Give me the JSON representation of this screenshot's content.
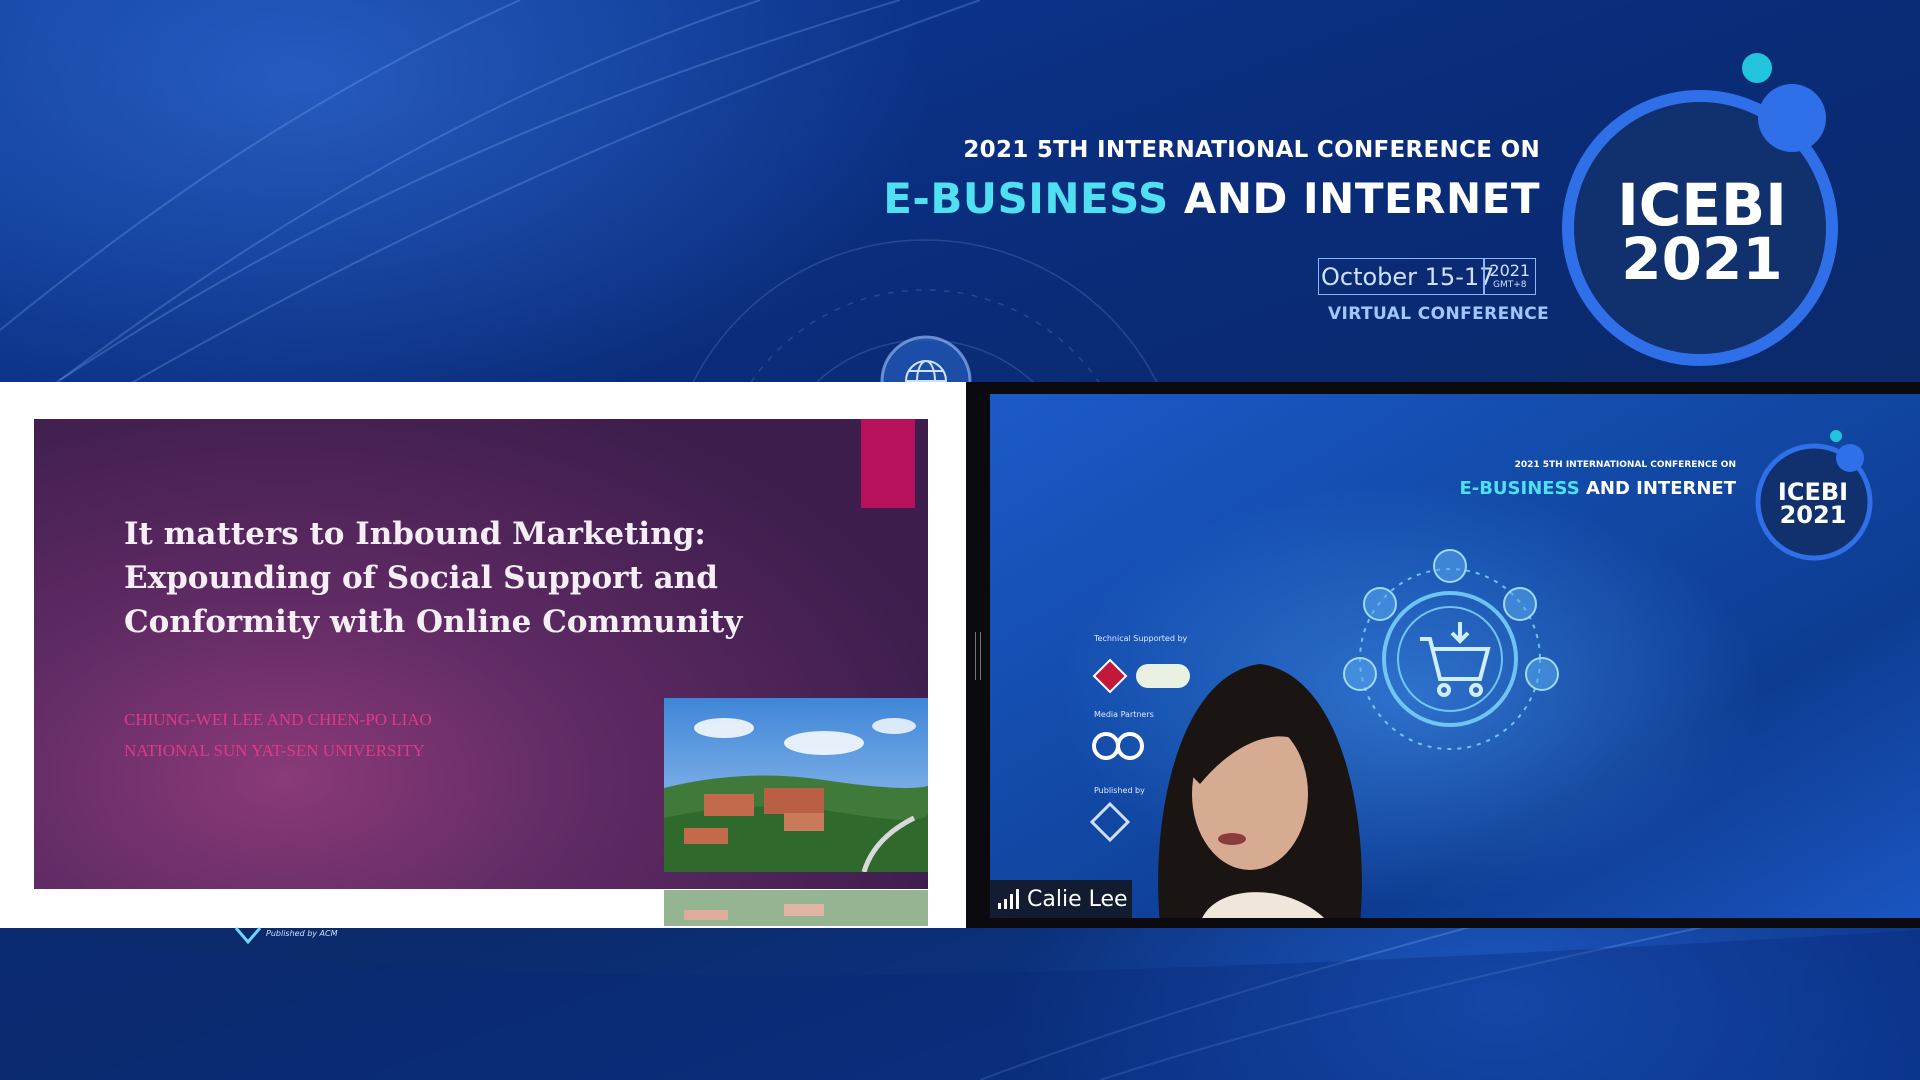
{
  "header": {
    "line1": "2021 5TH INTERNATIONAL CONFERENCE ON",
    "line2_accent": "E-BUSINESS",
    "line2_rest": " AND INTERNET",
    "date": "October 15-17",
    "year": "2021",
    "timezone": "GMT+8",
    "mode": "VIRTUAL CONFERENCE",
    "logo_line1": "ICEBI",
    "logo_line2": "2021"
  },
  "slide": {
    "title_lines": [
      "It matters to Inbound Marketing:",
      "Expounding of Social Support and",
      "Conformity with Online Community"
    ],
    "authors": "CHIUNG-WEI LEE AND CHIEN-PO LIAO",
    "affiliation": "NATIONAL SUN YAT-SEN UNIVERSITY"
  },
  "video": {
    "participant_name": "Calie Lee",
    "line1": "2021 5TH INTERNATIONAL CONFERENCE ON",
    "line2_accent": "E-BUSINESS",
    "line2_rest": " AND INTERNET",
    "logo_line1": "ICEBI",
    "logo_line2": "2021",
    "label_tech": "Technical Supported by",
    "label_media": "Media Partners",
    "label_published": "Published by"
  },
  "footer": {
    "published_by": "Published by ACM"
  },
  "colors": {
    "accent_cyan": "#4fe0f2",
    "background_blue": "#0a2c7a",
    "slide_purple": "#5e2a63",
    "slide_tab": "#b8115c",
    "author_pink": "#e0388a",
    "logo_ring": "#2f6fe8"
  },
  "icons": [
    "globe-icon",
    "signal-bars-icon",
    "shopping-cart-icon",
    "acm-logo-icon"
  ]
}
